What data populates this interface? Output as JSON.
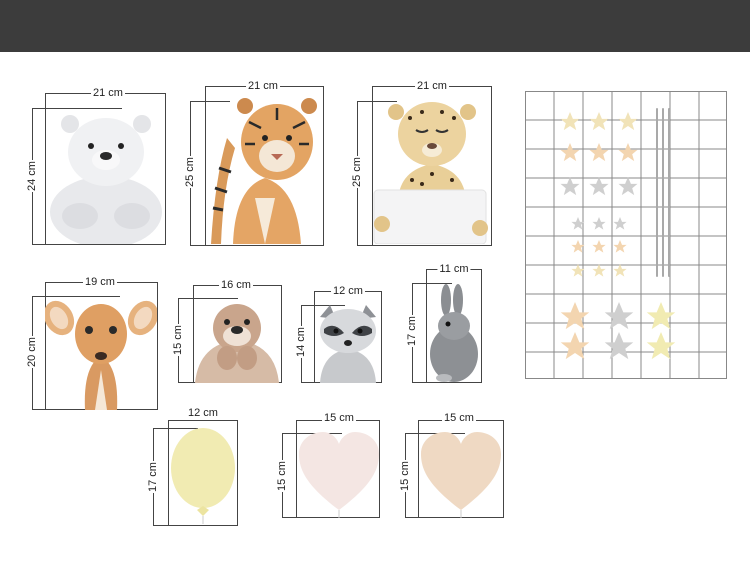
{
  "colors": {
    "top_bar": "#3c3c3c",
    "frame_line": "#444444",
    "star_gold": "#f1e3b8",
    "star_peach": "#f3d5b0",
    "star_grey": "#cfcfcf",
    "balloon_yellow": "#f1ebb2",
    "heart_pink": "#f4e6e3",
    "heart_peach": "#efd9c3"
  },
  "stickers": [
    {
      "name": "polar-bear",
      "width": "21 cm",
      "height": "24 cm"
    },
    {
      "name": "tiger",
      "width": "21 cm",
      "height": "25 cm"
    },
    {
      "name": "cheetah",
      "width": "21 cm",
      "height": "25 cm"
    },
    {
      "name": "deer",
      "width": "19 cm",
      "height": "20 cm"
    },
    {
      "name": "otter",
      "width": "16 cm",
      "height": "15 cm"
    },
    {
      "name": "raccoon",
      "width": "12 cm",
      "height": "14 cm"
    },
    {
      "name": "bunny",
      "width": "11 cm",
      "height": "17 cm"
    },
    {
      "name": "balloon",
      "width": "12 cm",
      "height": "17 cm"
    },
    {
      "name": "heart-pink",
      "width": "15 cm",
      "height": "15 cm"
    },
    {
      "name": "heart-peach",
      "width": "15 cm",
      "height": "15 cm"
    }
  ]
}
